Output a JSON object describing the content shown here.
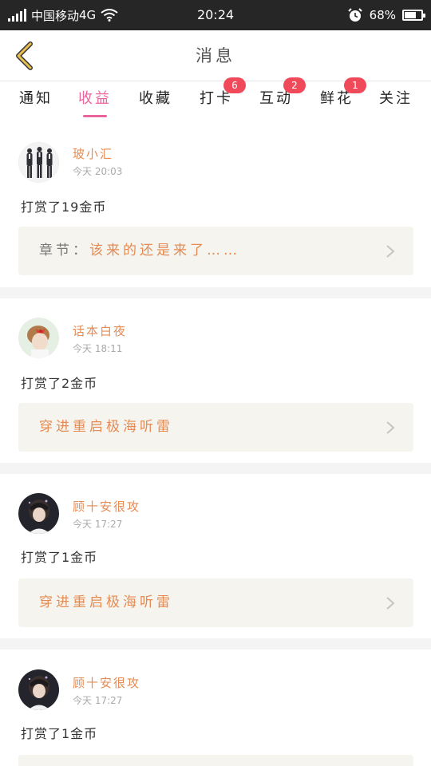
{
  "status": {
    "carrier": "中国移动",
    "network": "4G",
    "time": "20:24",
    "battery": "68%",
    "battery_level": 0.68,
    "signal_icon": "signal-icon",
    "wifi_icon": "wifi-icon",
    "alarm_icon": "alarm-icon"
  },
  "header": {
    "title": "消息",
    "back_icon": "chevron-left-icon",
    "back_color": "#c9a23a"
  },
  "tabs": [
    {
      "label": "通知",
      "badge": ""
    },
    {
      "label": "收益",
      "badge": "",
      "active": true
    },
    {
      "label": "收藏",
      "badge": ""
    },
    {
      "label": "打卡",
      "badge": "6"
    },
    {
      "label": "互动",
      "badge": "2"
    },
    {
      "label": "鲜花",
      "badge": "1"
    },
    {
      "label": "关注",
      "badge": ""
    }
  ],
  "messages": [
    {
      "sender": "玻小汇",
      "time": "今天 20:03",
      "action": "打赏了19金币",
      "ref_label": "章节：",
      "ref_title": "该来的还是来了……"
    },
    {
      "sender": "话本白夜",
      "time": "今天 18:11",
      "action": "打赏了2金币",
      "ref_label": "",
      "ref_title": "穿进重启极海听雷"
    },
    {
      "sender": "顾十安很攻",
      "time": "今天 17:27",
      "action": "打赏了1金币",
      "ref_label": "",
      "ref_title": "穿进重启极海听雷"
    },
    {
      "sender": "顾十安很攻",
      "time": "今天 17:27",
      "action": "打赏了1金币",
      "ref_label": "",
      "ref_title": ""
    }
  ],
  "colors": {
    "accent": "#e9659b",
    "sender": "#e58b53",
    "badge": "#f04a5a",
    "status_bar": "#262626"
  }
}
